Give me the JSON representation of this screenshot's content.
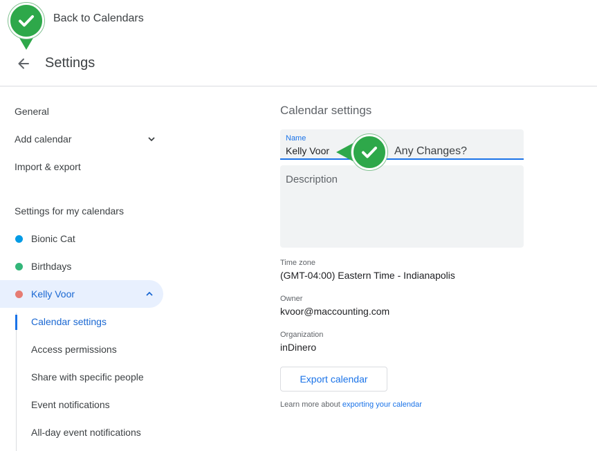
{
  "header": {
    "title": "Settings"
  },
  "callouts": {
    "back": "Back to Calendars",
    "name_field": "Any Changes?"
  },
  "sidebar": {
    "items": [
      {
        "label": "General"
      },
      {
        "label": "Add calendar"
      },
      {
        "label": "Import & export"
      }
    ],
    "my_calendars_heading": "Settings for my calendars",
    "calendars": [
      {
        "label": "Bionic Cat",
        "color": "#039be5"
      },
      {
        "label": "Birthdays",
        "color": "#33b679"
      },
      {
        "label": "Kelly Voor",
        "color": "#e67c73"
      }
    ],
    "sub_items": [
      {
        "label": "Calendar settings"
      },
      {
        "label": "Access permissions"
      },
      {
        "label": "Share with specific people"
      },
      {
        "label": "Event notifications"
      },
      {
        "label": "All-day event notifications"
      }
    ]
  },
  "main": {
    "title": "Calendar settings",
    "name_label": "Name",
    "name_value": "Kelly Voor",
    "description_placeholder": "Description",
    "timezone_label": "Time zone",
    "timezone_value": "(GMT-04:00) Eastern Time - Indianapolis",
    "owner_label": "Owner",
    "owner_value": "kvoor@maccounting.com",
    "org_label": "Organization",
    "org_value": "inDinero",
    "export_label": "Export calendar",
    "learn_prefix": "Learn more about",
    "learn_link": "exporting your calendar"
  }
}
